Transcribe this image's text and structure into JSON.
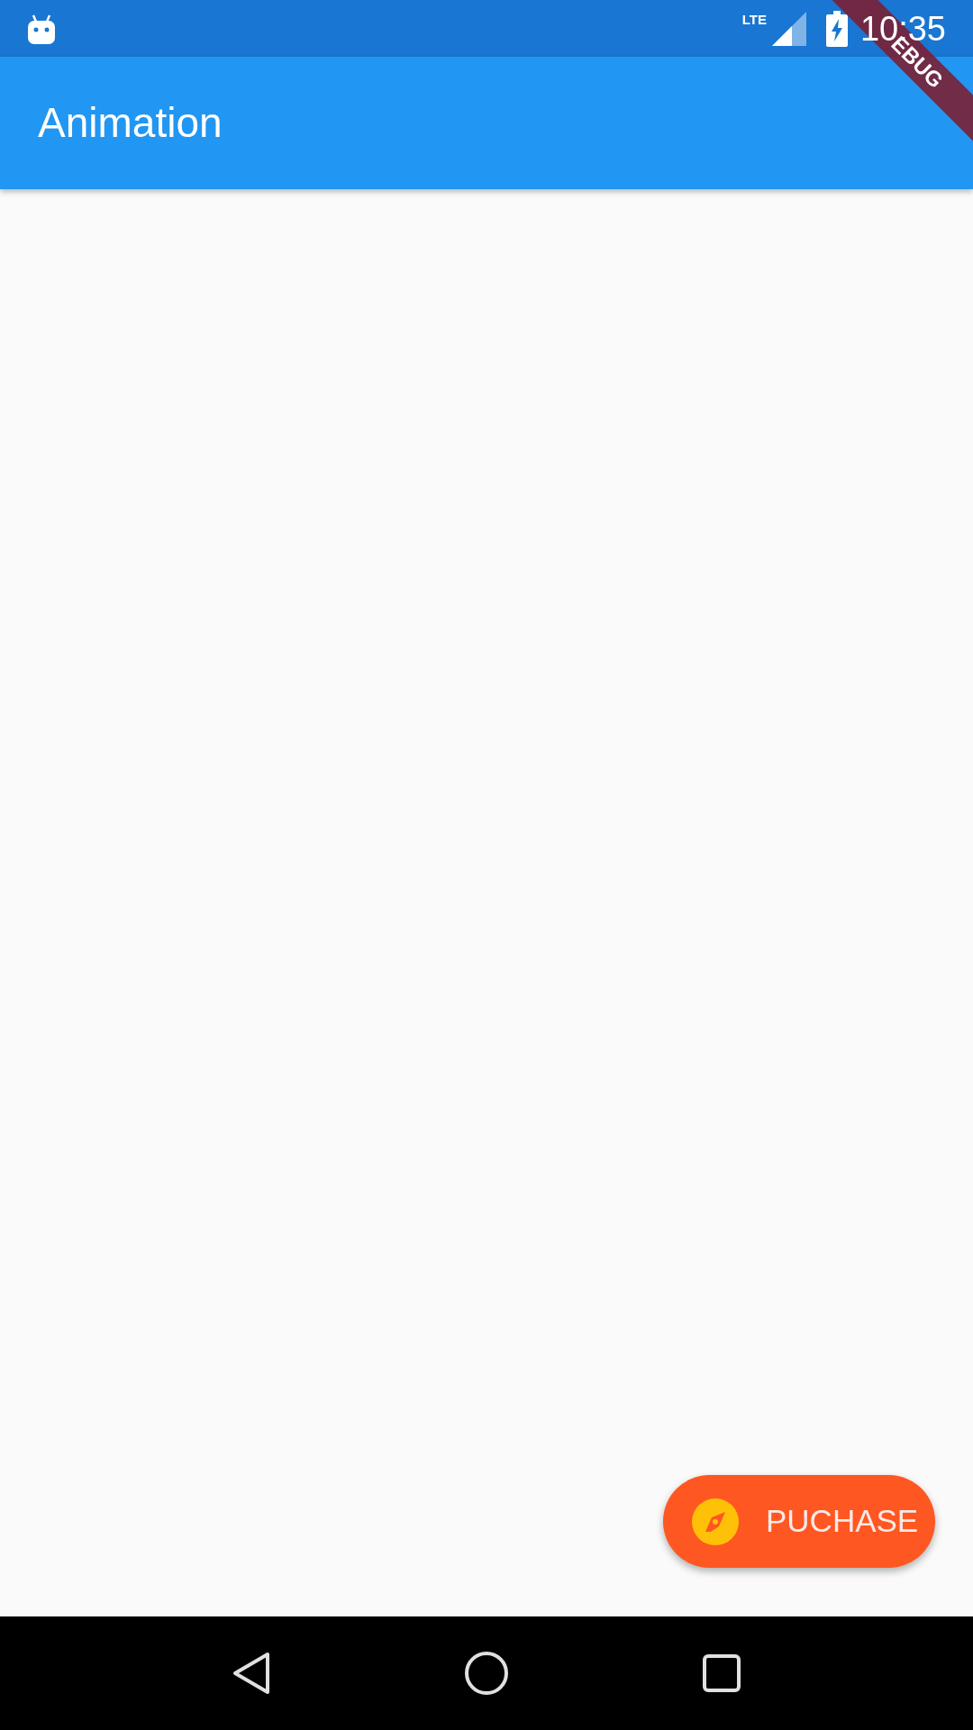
{
  "status_bar": {
    "time": "10:35",
    "network": "LTE"
  },
  "app_bar": {
    "title": "Animation"
  },
  "debug_banner": {
    "label": "EBUG"
  },
  "fab": {
    "label": "PUCHASE"
  }
}
